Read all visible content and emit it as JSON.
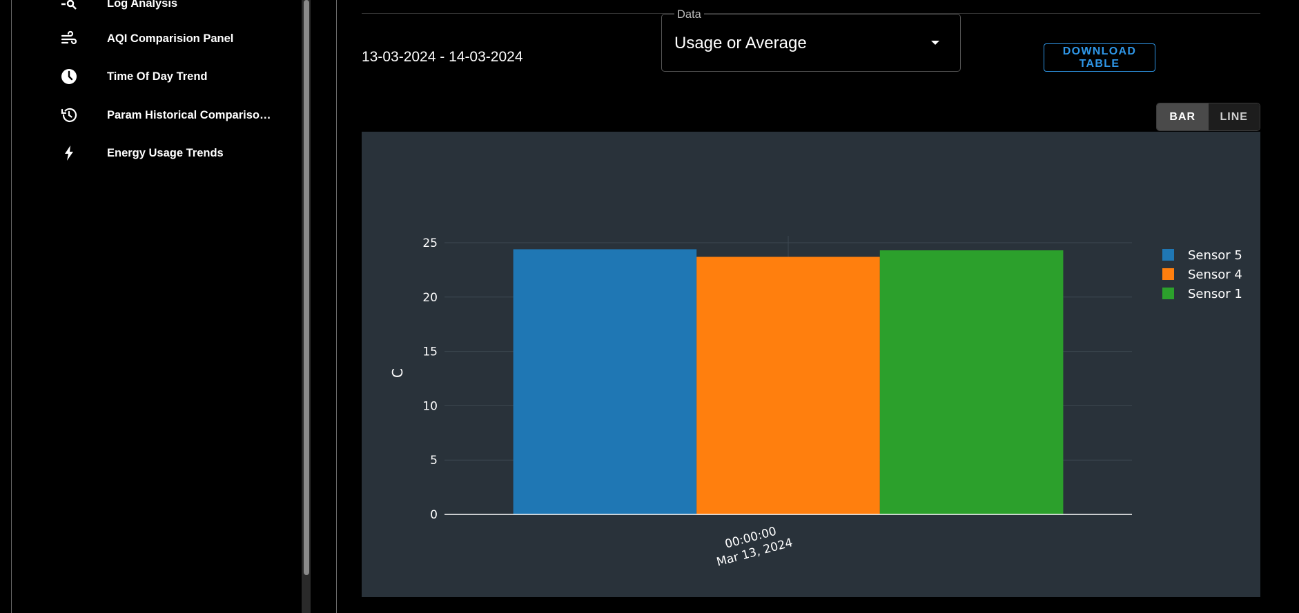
{
  "sidebar": {
    "items": [
      {
        "label": "Log Analysis",
        "icon": "log-search-icon"
      },
      {
        "label": "AQI Comparision Panel",
        "icon": "wind-icon"
      },
      {
        "label": "Time Of Day Trend",
        "icon": "clock-icon"
      },
      {
        "label": "Param Historical Compariso…",
        "icon": "history-icon"
      },
      {
        "label": "Energy Usage Trends",
        "icon": "lightning-icon"
      }
    ]
  },
  "header": {
    "date_range": "13-03-2024 - 14-03-2024",
    "data_select": {
      "legend": "Data",
      "value": "Usage or Average"
    },
    "download_label": "DOWNLOAD TABLE",
    "toggle": {
      "bar": "BAR",
      "line": "LINE",
      "active": "BAR"
    }
  },
  "colors": {
    "accent": "#2f97e8",
    "chart_bg": "#29323a"
  },
  "chart_data": {
    "type": "bar",
    "x_tick": [
      "00:00:00",
      "Mar 13, 2024"
    ],
    "ylabel": "C",
    "ylim": [
      0,
      25
    ],
    "yticks": [
      0,
      5,
      10,
      15,
      20,
      25
    ],
    "legend_position": "top-right",
    "series": [
      {
        "name": "Sensor 5",
        "value": 24.4,
        "color": "#1f77b4"
      },
      {
        "name": "Sensor 4",
        "value": 23.7,
        "color": "#ff7f0e"
      },
      {
        "name": "Sensor 1",
        "value": 24.3,
        "color": "#2ca02c"
      }
    ]
  }
}
